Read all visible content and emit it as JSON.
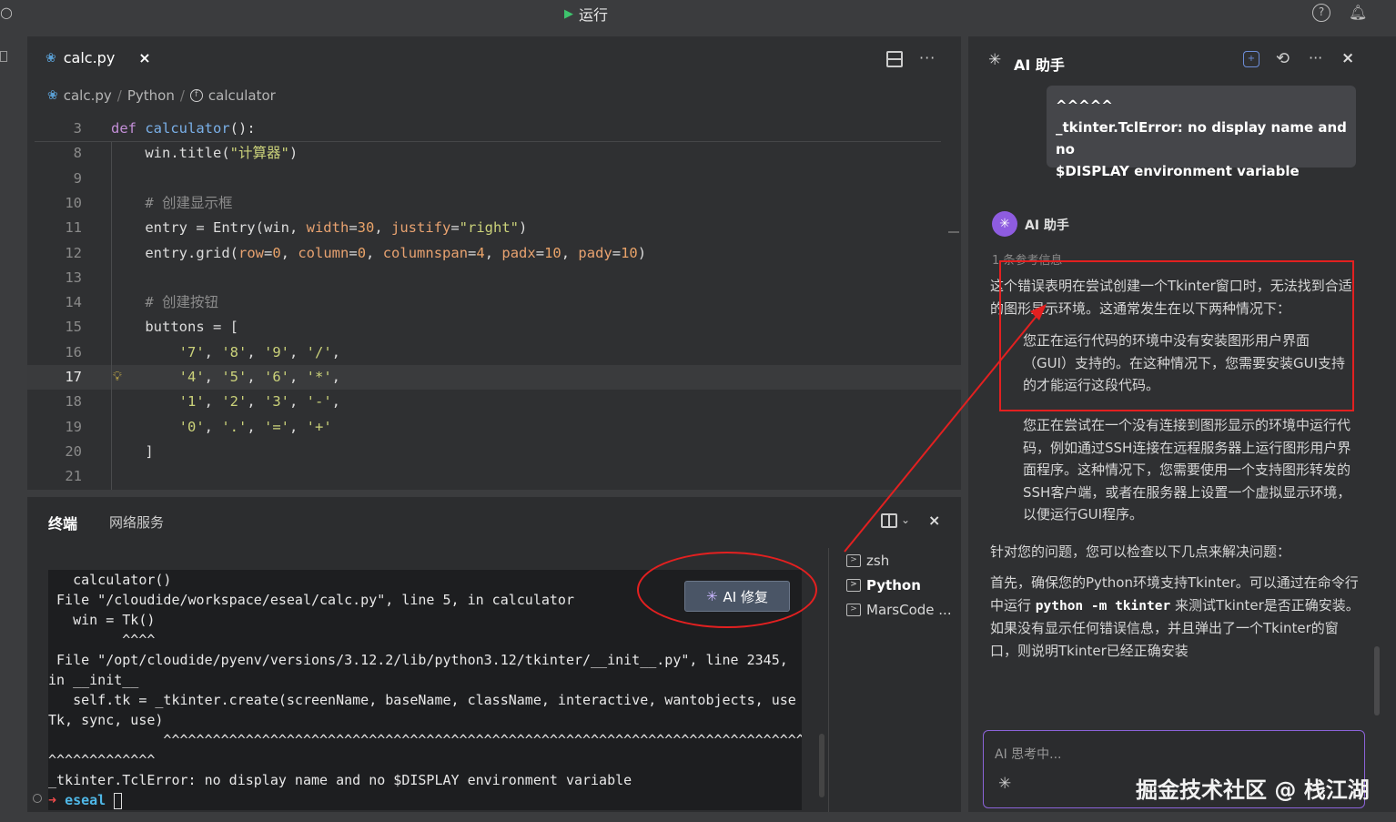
{
  "topbar": {
    "run_label": "运行",
    "run_icon": "play-icon",
    "help_icon": "help-icon",
    "bell_icon": "bell-icon",
    "search_icon": "search-icon"
  },
  "editor": {
    "tab": {
      "filename": "calc.py",
      "close": "×"
    },
    "breadcrumb": {
      "file": "calc.py",
      "lang": "Python",
      "sep": "/",
      "symbol": "calculator"
    },
    "current_line": "17",
    "lines": [
      {
        "n": "3",
        "tokens": [
          {
            "c": "kw",
            "t": "def "
          },
          {
            "c": "fn",
            "t": "calculator"
          },
          {
            "c": "",
            "t": "():"
          }
        ]
      },
      {
        "n": "8",
        "tokens": [
          {
            "c": "",
            "t": "    win.title("
          },
          {
            "c": "st",
            "t": "\"计算器\""
          },
          {
            "c": "",
            "t": ")"
          }
        ]
      },
      {
        "n": "9",
        "tokens": []
      },
      {
        "n": "10",
        "tokens": [
          {
            "c": "cm",
            "t": "    # 创建显示框"
          }
        ]
      },
      {
        "n": "11",
        "tokens": [
          {
            "c": "",
            "t": "    entry = Entry(win, "
          },
          {
            "c": "pr",
            "t": "width"
          },
          {
            "c": "",
            "t": "="
          },
          {
            "c": "nu",
            "t": "30"
          },
          {
            "c": "",
            "t": ", "
          },
          {
            "c": "pr",
            "t": "justify"
          },
          {
            "c": "",
            "t": "="
          },
          {
            "c": "st",
            "t": "\"right\""
          },
          {
            "c": "",
            "t": ")"
          }
        ]
      },
      {
        "n": "12",
        "tokens": [
          {
            "c": "",
            "t": "    entry.grid("
          },
          {
            "c": "pr",
            "t": "row"
          },
          {
            "c": "",
            "t": "="
          },
          {
            "c": "nu",
            "t": "0"
          },
          {
            "c": "",
            "t": ", "
          },
          {
            "c": "pr",
            "t": "column"
          },
          {
            "c": "",
            "t": "="
          },
          {
            "c": "nu",
            "t": "0"
          },
          {
            "c": "",
            "t": ", "
          },
          {
            "c": "pr",
            "t": "columnspan"
          },
          {
            "c": "",
            "t": "="
          },
          {
            "c": "nu",
            "t": "4"
          },
          {
            "c": "",
            "t": ", "
          },
          {
            "c": "pr",
            "t": "padx"
          },
          {
            "c": "",
            "t": "="
          },
          {
            "c": "nu",
            "t": "10"
          },
          {
            "c": "",
            "t": ", "
          },
          {
            "c": "pr",
            "t": "pady"
          },
          {
            "c": "",
            "t": "="
          },
          {
            "c": "nu",
            "t": "10"
          },
          {
            "c": "",
            "t": ")"
          }
        ]
      },
      {
        "n": "13",
        "tokens": []
      },
      {
        "n": "14",
        "tokens": [
          {
            "c": "cm",
            "t": "    # 创建按钮"
          }
        ]
      },
      {
        "n": "15",
        "tokens": [
          {
            "c": "",
            "t": "    buttons = ["
          }
        ]
      },
      {
        "n": "16",
        "tokens": [
          {
            "c": "st",
            "t": "        '7'"
          },
          {
            "c": "",
            "t": ", "
          },
          {
            "c": "st",
            "t": "'8'"
          },
          {
            "c": "",
            "t": ", "
          },
          {
            "c": "st",
            "t": "'9'"
          },
          {
            "c": "",
            "t": ", "
          },
          {
            "c": "st",
            "t": "'/'"
          },
          {
            "c": "",
            "t": ","
          }
        ]
      },
      {
        "n": "17",
        "tokens": [
          {
            "c": "st",
            "t": "        '4'"
          },
          {
            "c": "",
            "t": ", "
          },
          {
            "c": "st",
            "t": "'5'"
          },
          {
            "c": "",
            "t": ", "
          },
          {
            "c": "st",
            "t": "'6'"
          },
          {
            "c": "",
            "t": ", "
          },
          {
            "c": "st",
            "t": "'*'"
          },
          {
            "c": "",
            "t": ","
          }
        ]
      },
      {
        "n": "18",
        "tokens": [
          {
            "c": "st",
            "t": "        '1'"
          },
          {
            "c": "",
            "t": ", "
          },
          {
            "c": "st",
            "t": "'2'"
          },
          {
            "c": "",
            "t": ", "
          },
          {
            "c": "st",
            "t": "'3'"
          },
          {
            "c": "",
            "t": ", "
          },
          {
            "c": "st",
            "t": "'-'"
          },
          {
            "c": "",
            "t": ","
          }
        ]
      },
      {
        "n": "19",
        "tokens": [
          {
            "c": "st",
            "t": "        '0'"
          },
          {
            "c": "",
            "t": ", "
          },
          {
            "c": "st",
            "t": "'.'"
          },
          {
            "c": "",
            "t": ", "
          },
          {
            "c": "st",
            "t": "'='"
          },
          {
            "c": "",
            "t": ", "
          },
          {
            "c": "st",
            "t": "'+'"
          }
        ]
      },
      {
        "n": "20",
        "tokens": [
          {
            "c": "",
            "t": "    ]"
          }
        ]
      },
      {
        "n": "21",
        "tokens": []
      }
    ]
  },
  "panel": {
    "tabs": [
      "终端",
      "网络服务"
    ],
    "terminal_lines": [
      "   calculator()",
      " File \"/cloudide/workspace/eseal/calc.py\", line 5, in calculator",
      "   win = Tk()",
      "         ^^^^",
      " File \"/opt/cloudide/pyenv/versions/3.12.2/lib/python3.12/tkinter/__init__.py\", line 2345,",
      "in __init__",
      "   self.tk = _tkinter.create(screenName, baseName, className, interactive, wantobjects, use",
      "Tk, sync, use)",
      "              ^^^^^^^^^^^^^^^^^^^^^^^^^^^^^^^^^^^^^^^^^^^^^^^^^^^^^^^^^^^^^^^^^^^^^^^^^^^^^^^^^^^^^",
      "^^^^^^^^^^^^^",
      "_tkinter.TclError: no display name and no $DISPLAY environment variable"
    ],
    "prompt_arrow": "➜",
    "prompt_dir": "eseal",
    "ai_fix_label": "AI 修复",
    "shells": [
      {
        "name": "zsh",
        "active": false
      },
      {
        "name": "Python",
        "active": true
      },
      {
        "name": "MarsCode ...",
        "active": false
      }
    ]
  },
  "ai": {
    "title": "AI 助手",
    "chip_lines": [
      "^^^^^",
      "_tkinter.TclError: no display name and no",
      "$DISPLAY environment variable"
    ],
    "assistant_name": "AI 助手",
    "refs": "1 条参考信息",
    "intro": "这个错误表明在尝试创建一个Tkinter窗口时，无法找到合适的图形显示环境。这通常发生在以下两种情况下：",
    "point1": "您正在运行代码的环境中没有安装图形用户界面（GUI）支持的。在这种情况下，您需要安装GUI支持的才能运行这段代码。",
    "point2": "您正在尝试在一个没有连接到图形显示的环境中运行代码，例如通过SSH连接在远程服务器上运行图形用户界面程序。这种情况下，您需要使用一个支持图形转发的SSH客户端，或者在服务器上设置一个虚拟显示环境，以便运行GUI程序。",
    "check": "针对您的问题，您可以检查以下几点来解决问题：",
    "first_a": "首先，确保您的Python环境支持Tkinter。可以通过在命令行中运行 ",
    "first_cmd": "python -m tkinter",
    "first_b": " 来测试Tkinter是否正确安装。如果没有显示任何错误信息，并且弹出了一个Tkinter的窗口，则说明Tkinter已经正确安装",
    "input_placeholder": "AI 思考中..."
  },
  "watermark": "掘金技术社区 @ 栈江湖"
}
